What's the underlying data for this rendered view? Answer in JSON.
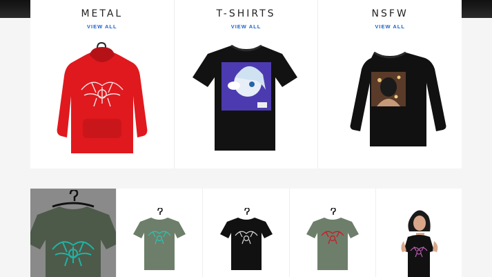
{
  "collections": [
    {
      "title": "METAL",
      "link": "VIEW ALL",
      "product_color": "#e0191e"
    },
    {
      "title": "T-SHIRTS",
      "link": "VIEW ALL",
      "product_color": "#111111"
    },
    {
      "title": "NSFW",
      "link": "VIEW ALL",
      "product_color": "#111111"
    }
  ],
  "thumbnails": [
    {
      "shirt_color": "#4d5a4a",
      "print_color": "#1fb3a4"
    },
    {
      "shirt_color": "#6d7f6a",
      "print_color": "#2bc4b4"
    },
    {
      "shirt_color": "#111111",
      "print_color": "#d8d8d8"
    },
    {
      "shirt_color": "#6d7f6a",
      "print_color": "#c4202a"
    },
    {
      "shirt_color": "#111111",
      "print_color": "#c05cb8"
    }
  ]
}
